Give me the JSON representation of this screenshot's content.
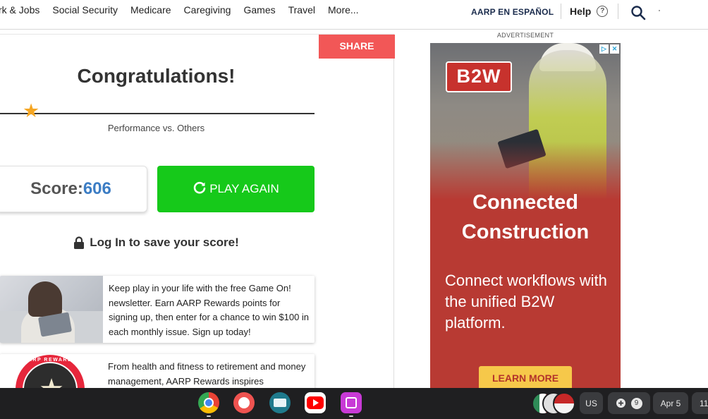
{
  "nav": {
    "links": [
      "rk & Jobs",
      "Social Security",
      "Medicare",
      "Caregiving",
      "Games",
      "Travel",
      "More..."
    ],
    "espanol": "AARP EN ESPAÑOL",
    "help": "Help",
    "help_icon_glyph": "?"
  },
  "game": {
    "share_label": "SHARE",
    "title": "Congratulations!",
    "performance_label": "Performance vs. Others",
    "score_label": "Score:",
    "score_value": "606",
    "play_again_label": "PLAY AGAIN",
    "login_label": "Log In to save your score!"
  },
  "promos": [
    {
      "text": "Keep play in your life with the free Game On! newsletter. Earn AARP Rewards points for signing up, then enter for a chance to win $100 in each monthly issue. Sign up today!"
    },
    {
      "text": "From health and fitness to retirement and money management, AARP Rewards inspires",
      "badge_text": "AARP REWARDS"
    }
  ],
  "ad": {
    "label": "ADVERTISEMENT",
    "logo": "B2W",
    "headline_line1": "Connected",
    "headline_line2": "Construction",
    "body": "Connect workflows with the unified B2W platform.",
    "cta": "LEARN MORE",
    "choices_icon": "▷",
    "close_icon": "✕"
  },
  "taskbar": {
    "apps": [
      "chrome-icon",
      "palette-icon",
      "news-icon",
      "youtube-icon",
      "photos-icon"
    ],
    "region": "US",
    "notification_count": "9",
    "date": "Apr 5",
    "time": "11"
  },
  "colors": {
    "share": "#f25757",
    "play_again": "#16c91a",
    "score_value": "#3c7dc4",
    "star": "#f5a623",
    "ad_background": "#b83a33",
    "ad_cta": "#f6c84a"
  }
}
